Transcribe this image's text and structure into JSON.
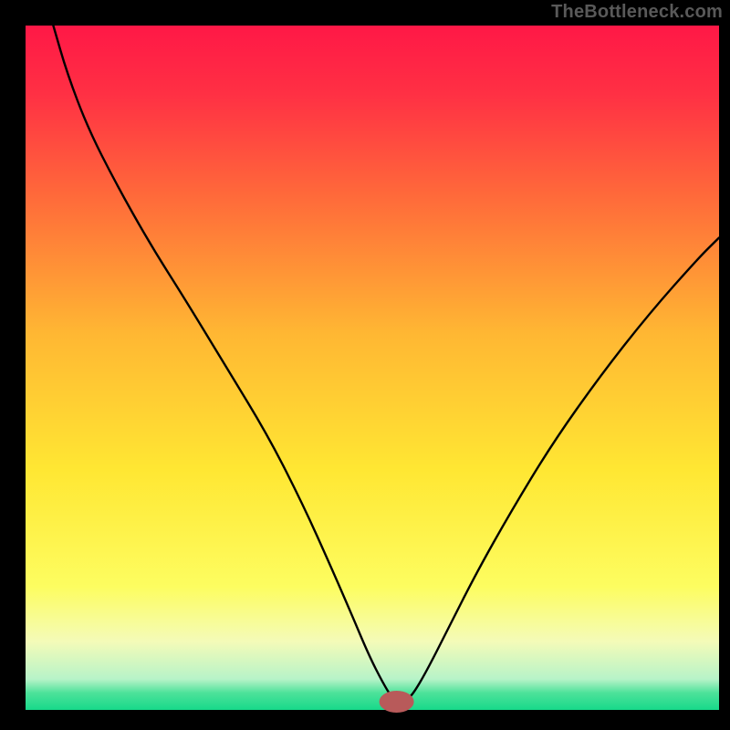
{
  "watermark": "TheBottleneck.com",
  "chart_data": {
    "type": "line",
    "title": "",
    "xlabel": "",
    "ylabel": "",
    "xlim": [
      0,
      100
    ],
    "ylim": [
      0,
      100
    ],
    "grid": false,
    "legend": false,
    "background_gradient": {
      "stops": [
        {
          "offset": 0.0,
          "color": "#ff1846"
        },
        {
          "offset": 0.1,
          "color": "#ff3044"
        },
        {
          "offset": 0.25,
          "color": "#ff6a3a"
        },
        {
          "offset": 0.45,
          "color": "#ffb733"
        },
        {
          "offset": 0.65,
          "color": "#ffe733"
        },
        {
          "offset": 0.82,
          "color": "#fdfd60"
        },
        {
          "offset": 0.9,
          "color": "#f4fbb8"
        },
        {
          "offset": 0.955,
          "color": "#b7f3c8"
        },
        {
          "offset": 0.975,
          "color": "#4de29a"
        },
        {
          "offset": 1.0,
          "color": "#17d98a"
        }
      ]
    },
    "marker": {
      "x": 53.5,
      "y": 1.2,
      "rx": 2.5,
      "ry": 1.6,
      "color": "#b85a5a"
    },
    "series": [
      {
        "name": "bottleneck-curve",
        "x": [
          4.0,
          6,
          9,
          13,
          18,
          23,
          29,
          35,
          40,
          44,
          47,
          49.5,
          51.5,
          53,
          55,
          56,
          58,
          61,
          65,
          70,
          76,
          83,
          90,
          97,
          100
        ],
        "values": [
          100,
          93,
          85,
          77,
          68,
          60,
          50,
          40,
          30,
          21,
          14,
          8,
          4,
          1.5,
          1.5,
          2.5,
          6,
          12,
          20,
          29,
          39,
          49,
          58,
          66,
          69
        ]
      }
    ]
  }
}
